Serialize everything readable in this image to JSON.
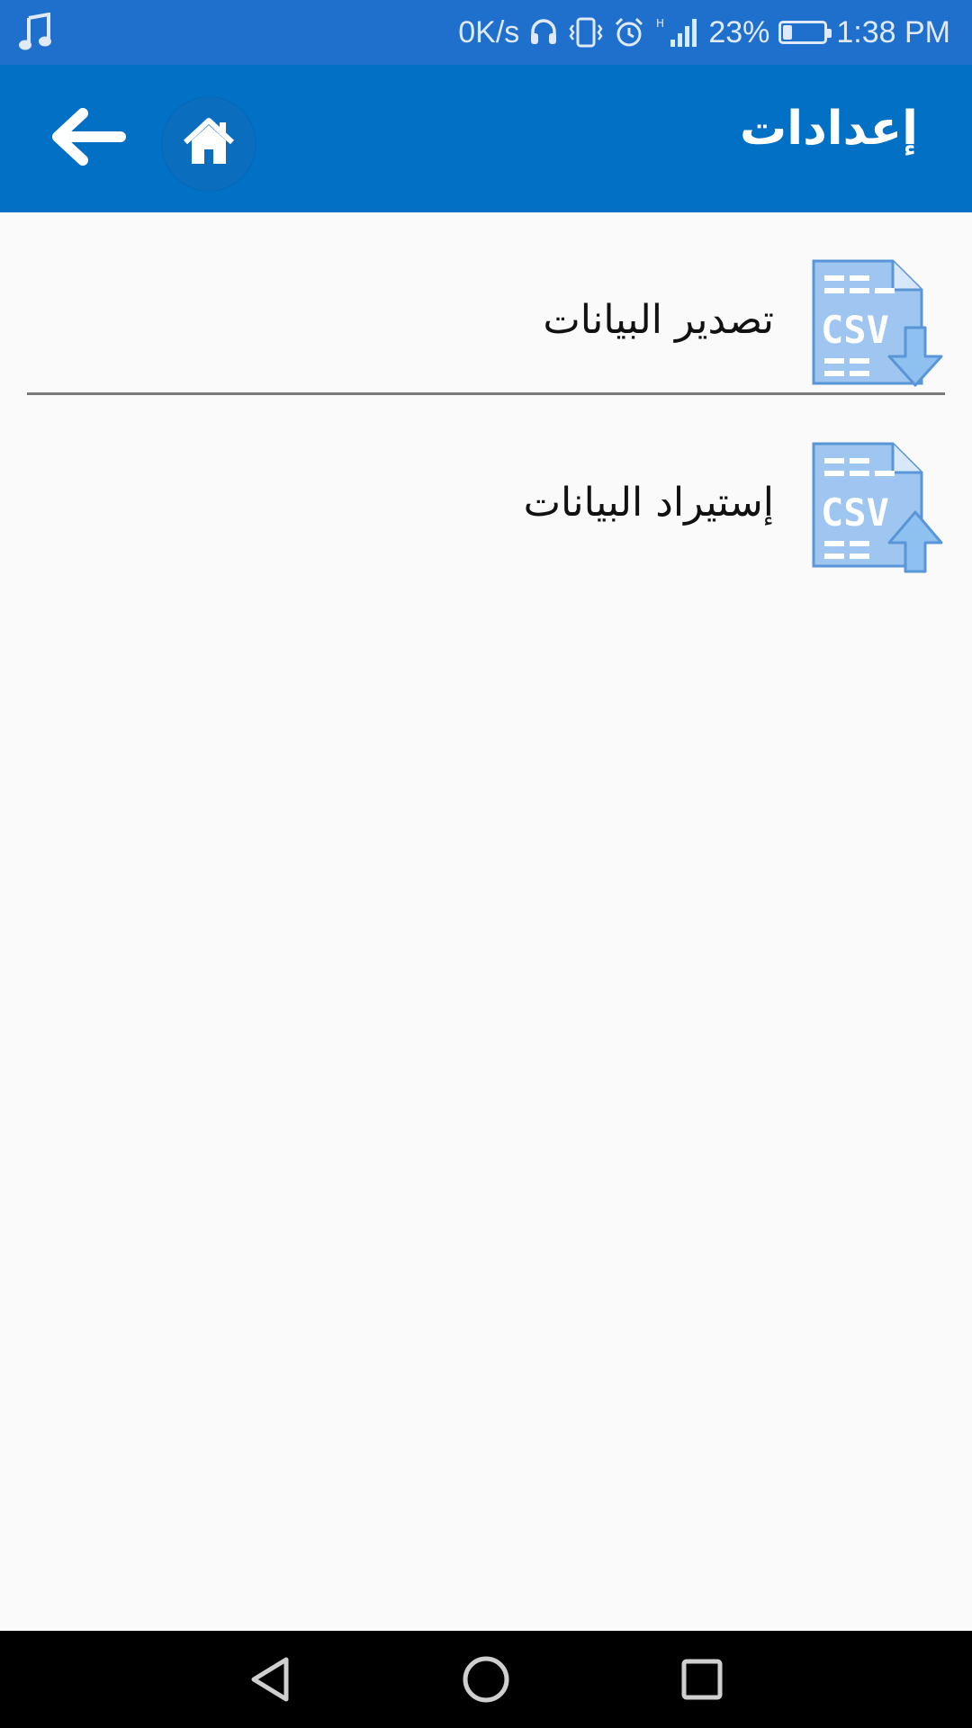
{
  "status_bar": {
    "speed": "0K/s",
    "battery": "23%",
    "battery_level": 0.23,
    "time": "1:38 PM",
    "network": "H"
  },
  "app_bar": {
    "title": "إعدادات"
  },
  "items": [
    {
      "label": "تصدير البيانات",
      "icon": "csv-export-icon"
    },
    {
      "label": "إستيراد البيانات",
      "icon": "csv-import-icon"
    }
  ],
  "colors": {
    "status_bar": "#1f6fcc",
    "app_bar": "#0270c5",
    "icon_blue": "#9ec6f0",
    "icon_dark": "#5a95d8"
  }
}
